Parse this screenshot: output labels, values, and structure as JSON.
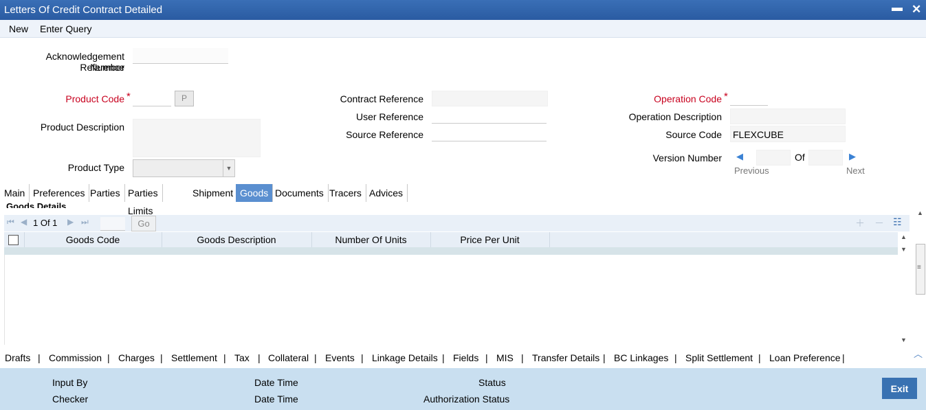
{
  "window": {
    "title": "Letters Of Credit Contract Detailed"
  },
  "toolbar": {
    "new": "New",
    "enter_query": "Enter Query"
  },
  "form": {
    "ack_ref_label_1": "Acknowledgement Reference",
    "ack_ref_label_2": "Number",
    "product_code_label": "Product Code",
    "required_mark": "*",
    "p_button": "P",
    "product_description_label": "Product Description",
    "product_type_label": "Product Type",
    "contract_reference_label": "Contract Reference",
    "user_reference_label": "User Reference",
    "source_reference_label": "Source Reference",
    "operation_code_label": "Operation Code",
    "operation_description_label": "Operation Description",
    "source_code_label": "Source Code",
    "source_code_value": "FLEXCUBE",
    "version_number_label": "Version Number",
    "of_label": "Of",
    "previous": "Previous",
    "next": "Next"
  },
  "tabs": [
    "Main",
    "Preferences",
    "Parties",
    "Parties Limits",
    "Shipment",
    "Goods",
    "Documents",
    "Tracers",
    "Advices"
  ],
  "goods": {
    "title": "Goods Details",
    "pager_text": "1 Of 1",
    "go": "Go",
    "columns": [
      "Goods Code",
      "Goods Description",
      "Number Of Units",
      "Price Per Unit"
    ]
  },
  "bottom_links": [
    "Drafts",
    "Commission",
    "Charges",
    "Settlement",
    "Tax",
    "Collateral",
    "Events",
    "Linkage Details",
    "Fields",
    "MIS",
    "Transfer Details",
    "BC Linkages",
    "Split Settlement",
    "Loan Preference"
  ],
  "footer": {
    "input_by": "Input By",
    "checker": "Checker",
    "date_time_1": "Date Time",
    "date_time_2": "Date Time",
    "status": "Status",
    "authorization_status": "Authorization Status",
    "exit": "Exit"
  },
  "colors": {
    "title_bar": "#2f62aa",
    "active_tab": "#5a8fd0",
    "required": "#c8001e",
    "footer": "#c9dff0"
  }
}
